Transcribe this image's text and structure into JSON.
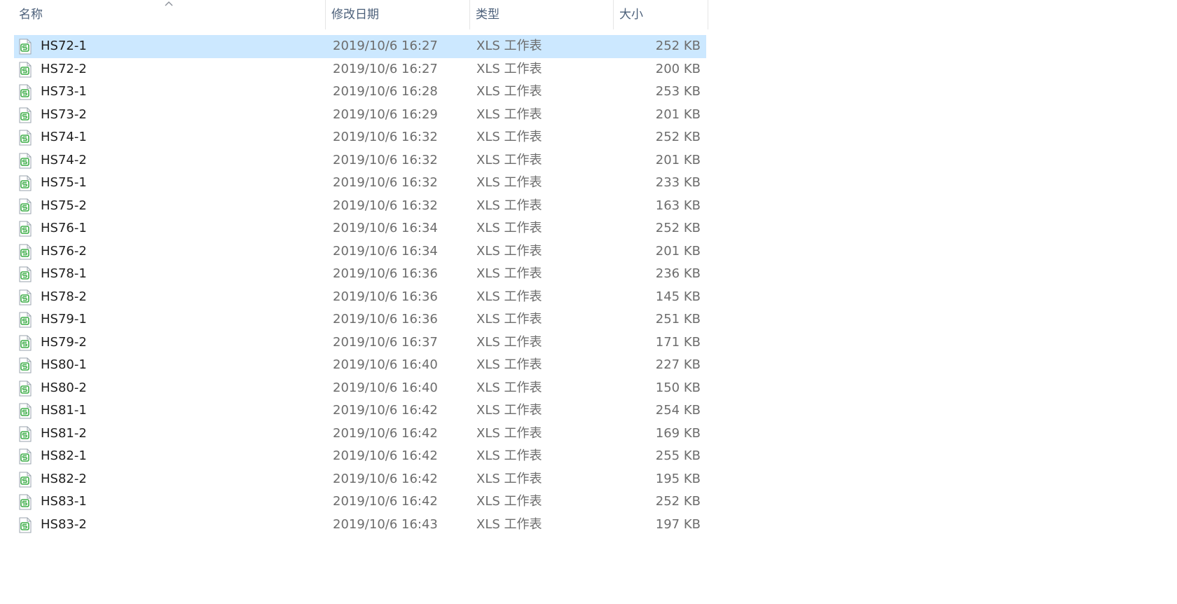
{
  "header": {
    "name": "名称",
    "date": "修改日期",
    "type": "类型",
    "size": "大小"
  },
  "colors": {
    "header_text": "#4c607a",
    "selection": "#cce8ff",
    "icon_green": "#3fae49"
  },
  "icons": {
    "file": "xls-spreadsheet-icon",
    "sort": "sort-ascending-icon"
  },
  "files": [
    {
      "name": "HS72-1",
      "date": "2019/10/6 16:27",
      "type": "XLS 工作表",
      "size": "252 KB",
      "selected": true
    },
    {
      "name": "HS72-2",
      "date": "2019/10/6 16:27",
      "type": "XLS 工作表",
      "size": "200 KB"
    },
    {
      "name": "HS73-1",
      "date": "2019/10/6 16:28",
      "type": "XLS 工作表",
      "size": "253 KB"
    },
    {
      "name": "HS73-2",
      "date": "2019/10/6 16:29",
      "type": "XLS 工作表",
      "size": "201 KB"
    },
    {
      "name": "HS74-1",
      "date": "2019/10/6 16:32",
      "type": "XLS 工作表",
      "size": "252 KB"
    },
    {
      "name": "HS74-2",
      "date": "2019/10/6 16:32",
      "type": "XLS 工作表",
      "size": "201 KB"
    },
    {
      "name": "HS75-1",
      "date": "2019/10/6 16:32",
      "type": "XLS 工作表",
      "size": "233 KB"
    },
    {
      "name": "HS75-2",
      "date": "2019/10/6 16:32",
      "type": "XLS 工作表",
      "size": "163 KB"
    },
    {
      "name": "HS76-1",
      "date": "2019/10/6 16:34",
      "type": "XLS 工作表",
      "size": "252 KB"
    },
    {
      "name": "HS76-2",
      "date": "2019/10/6 16:34",
      "type": "XLS 工作表",
      "size": "201 KB"
    },
    {
      "name": "HS78-1",
      "date": "2019/10/6 16:36",
      "type": "XLS 工作表",
      "size": "236 KB"
    },
    {
      "name": "HS78-2",
      "date": "2019/10/6 16:36",
      "type": "XLS 工作表",
      "size": "145 KB"
    },
    {
      "name": "HS79-1",
      "date": "2019/10/6 16:36",
      "type": "XLS 工作表",
      "size": "251 KB"
    },
    {
      "name": "HS79-2",
      "date": "2019/10/6 16:37",
      "type": "XLS 工作表",
      "size": "171 KB"
    },
    {
      "name": "HS80-1",
      "date": "2019/10/6 16:40",
      "type": "XLS 工作表",
      "size": "227 KB"
    },
    {
      "name": "HS80-2",
      "date": "2019/10/6 16:40",
      "type": "XLS 工作表",
      "size": "150 KB"
    },
    {
      "name": "HS81-1",
      "date": "2019/10/6 16:42",
      "type": "XLS 工作表",
      "size": "254 KB"
    },
    {
      "name": "HS81-2",
      "date": "2019/10/6 16:42",
      "type": "XLS 工作表",
      "size": "169 KB"
    },
    {
      "name": "HS82-1",
      "date": "2019/10/6 16:42",
      "type": "XLS 工作表",
      "size": "255 KB"
    },
    {
      "name": "HS82-2",
      "date": "2019/10/6 16:42",
      "type": "XLS 工作表",
      "size": "195 KB"
    },
    {
      "name": "HS83-1",
      "date": "2019/10/6 16:42",
      "type": "XLS 工作表",
      "size": "252 KB"
    },
    {
      "name": "HS83-2",
      "date": "2019/10/6 16:43",
      "type": "XLS 工作表",
      "size": "197 KB"
    }
  ]
}
